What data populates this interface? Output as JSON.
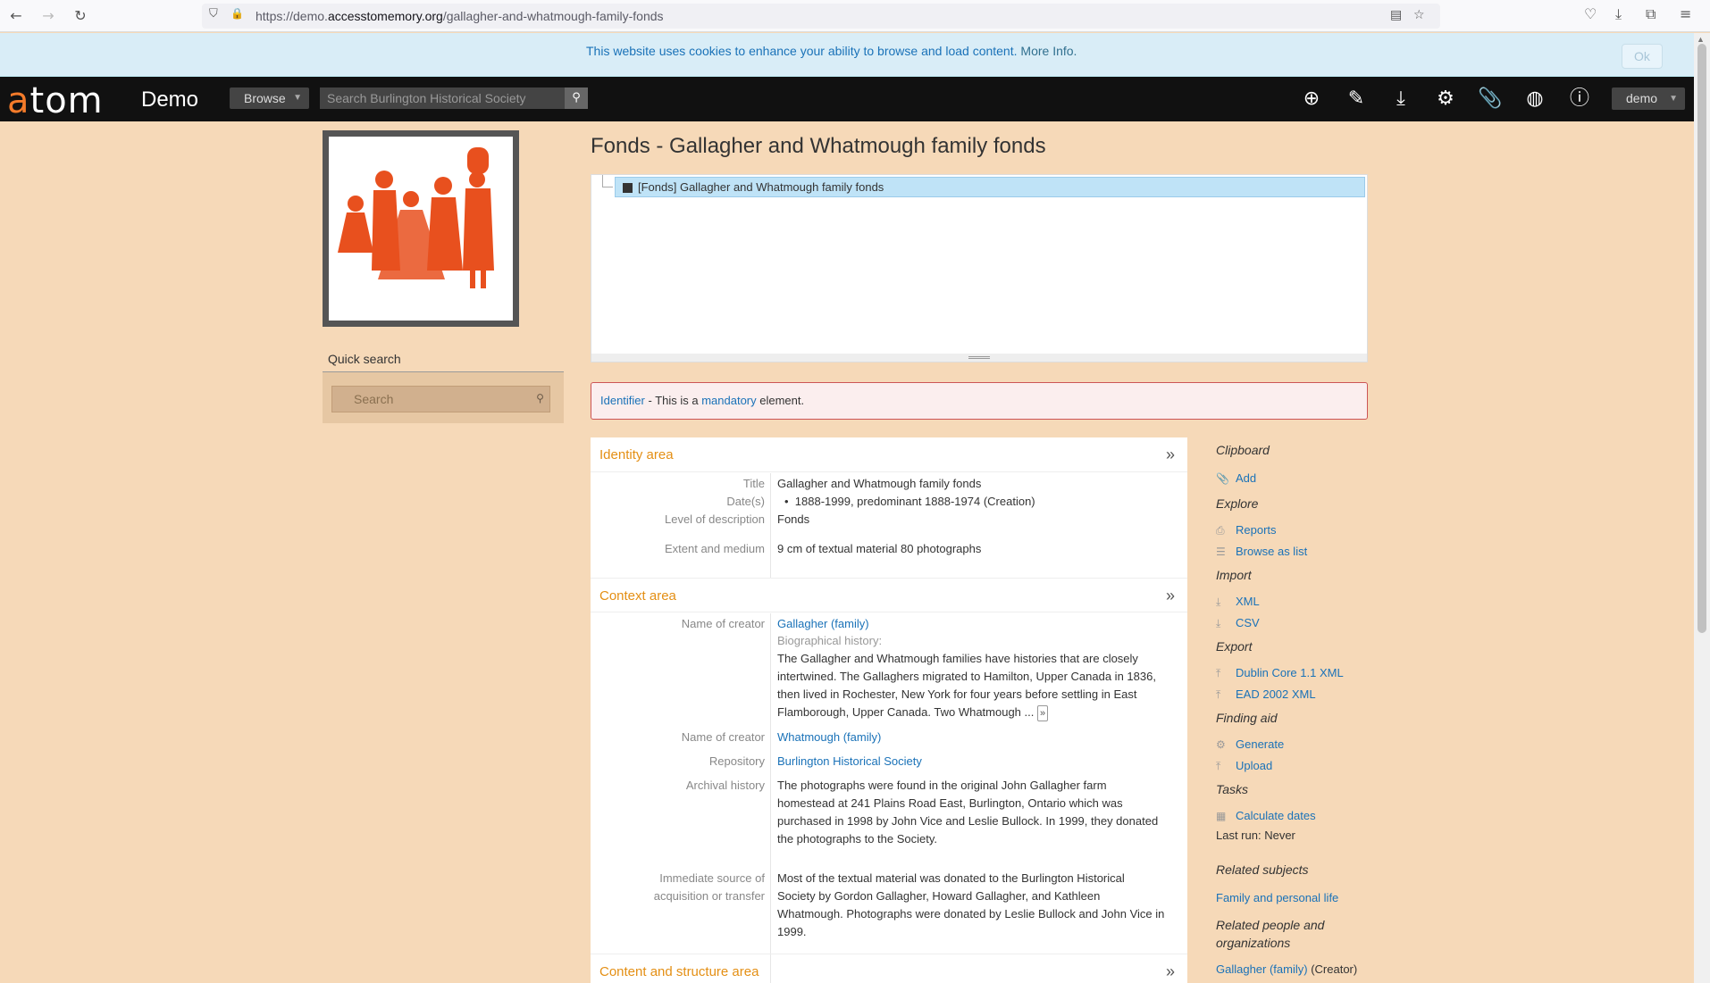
{
  "browser": {
    "url_prefix": "https://demo.",
    "url_domain": "accesstomemory.org",
    "url_path": "/gallagher-and-whatmough-family-fonds"
  },
  "cookie": {
    "text": "This website uses cookies to enhance your ability to browse and load content.",
    "more": "More Info.",
    "ok": "Ok"
  },
  "header": {
    "logo_a": "a",
    "logo_rest": "tom",
    "site_name": "Demo",
    "browse_label": "Browse",
    "search_placeholder": "Search Burlington Historical Society",
    "user_label": "demo"
  },
  "left": {
    "quick_search_title": "Quick search",
    "quick_search_placeholder": "Search"
  },
  "page": {
    "title": "Fonds - Gallagher and Whatmough family fonds",
    "tree_item": "[Fonds] Gallagher and Whatmough family fonds"
  },
  "alert": {
    "identifier": "Identifier",
    "middle": " - This is a ",
    "mandatory": "mandatory",
    "end": " element."
  },
  "identity": {
    "title": "Identity area",
    "toggle": "»",
    "fields": {
      "title_label": "Title",
      "title_value": "Gallagher and Whatmough family fonds",
      "dates_label": "Date(s)",
      "dates_value": "1888-1999, predominant 1888-1974 (Creation)",
      "level_label": "Level of description",
      "level_value": "Fonds",
      "extent_label": "Extent and medium",
      "extent_value": "9 cm of textual material 80 photographs"
    }
  },
  "context": {
    "title": "Context area",
    "toggle": "»",
    "creator1_label": "Name of creator",
    "creator1_value": "Gallagher (family)",
    "bio_label": "Biographical history:",
    "bio_line1": "The Gallagher and Whatmough families have histories that are closely",
    "bio_line2": "intertwined. The Gallaghers migrated to Hamilton, Upper Canada in 1836,",
    "bio_line3": "then lived in Rochester, New York for four years before settling in East",
    "bio_line4": "Flamborough, Upper Canada. Two Whatmough ...",
    "bio_more": "»",
    "creator2_label": "Name of creator",
    "creator2_value": "Whatmough (family)",
    "repo_label": "Repository",
    "repo_value": "Burlington Historical Society",
    "archival_label": "Archival history",
    "archival_line1": "The photographs were found in the original John Gallagher farm",
    "archival_line2": "homestead at 241 Plains Road East, Burlington, Ontario which was",
    "archival_line3": "purchased in 1998 by John Vice and Leslie Bullock. In 1999, they donated",
    "archival_line4": "the photographs to the Society.",
    "source_label1": "Immediate source of",
    "source_label2": "acquisition or transfer",
    "source_line1": "Most of the textual material was donated to the Burlington Historical",
    "source_line2": "Society by Gordon Gallagher, Howard Gallagher, and Kathleen",
    "source_line3": "Whatmough. Photographs were donated by Leslie Bullock and John Vice in",
    "source_line4": "1999."
  },
  "content_structure": {
    "title": "Content and structure area",
    "toggle": "»"
  },
  "sidebar": {
    "clipboard": "Clipboard",
    "add": "Add",
    "explore": "Explore",
    "reports": "Reports",
    "browse_list": "Browse as list",
    "import": "Import",
    "xml": "XML",
    "csv": "CSV",
    "export": "Export",
    "dublin": "Dublin Core 1.1 XML",
    "ead": "EAD 2002 XML",
    "finding_aid": "Finding aid",
    "generate": "Generate",
    "upload": "Upload",
    "tasks": "Tasks",
    "calc_dates": "Calculate dates",
    "last_run": "Last run: Never",
    "related_subjects": "Related subjects",
    "family_life": "Family and personal life",
    "related_people_1": "Related people and",
    "related_people_2": "organizations",
    "gallagher_creator": "Gallagher (family)",
    "creator_suffix": " (Creator)"
  }
}
